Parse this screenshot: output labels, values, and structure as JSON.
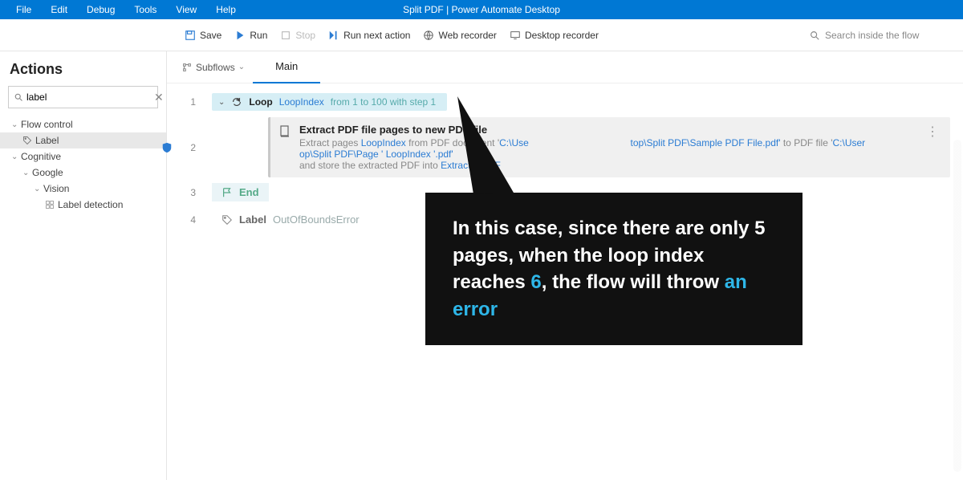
{
  "menubar": {
    "items": [
      "File",
      "Edit",
      "Debug",
      "Tools",
      "View",
      "Help"
    ],
    "title": "Split PDF | Power Automate Desktop"
  },
  "toolbar": {
    "save": "Save",
    "run": "Run",
    "stop": "Stop",
    "run_next": "Run next action",
    "web_rec": "Web recorder",
    "desk_rec": "Desktop recorder",
    "search_placeholder": "Search inside the flow"
  },
  "sidebar": {
    "title": "Actions",
    "search_value": "label",
    "tree": {
      "flow_control": "Flow control",
      "label_action": "Label",
      "cognitive": "Cognitive",
      "google": "Google",
      "vision": "Vision",
      "label_detection": "Label detection"
    }
  },
  "subflows": {
    "btn": "Subflows",
    "tab_main": "Main"
  },
  "flow": {
    "row1": {
      "num": "1",
      "name": "Loop",
      "var": "LoopIndex",
      "meta": "from 1 to 100 with step 1"
    },
    "row2": {
      "num": "2",
      "title": "Extract PDF file pages to new PDF file",
      "desc_pre": "Extract pages ",
      "var1": "LoopIndex",
      "desc_mid1": " from PDF document '",
      "path1": "C:\\Use",
      "path1b": "top\\Split PDF\\Sample PDF File.pdf'",
      "desc_mid2": " to PDF file '",
      "path2": "C:\\User",
      "path2b": "op\\Split PDF\\Page ' ",
      "var2": "LoopIndex",
      "path2c": " '.pdf'",
      "desc_line2_pre": "and store the extracted PDF into ",
      "var3": "ExtractedPDF"
    },
    "row3": {
      "num": "3",
      "name": "End"
    },
    "row4": {
      "num": "4",
      "name": "Label",
      "val": "OutOfBoundsError"
    }
  },
  "callout": {
    "t1": "In this case, since there are only 5 pages, when the loop index reaches ",
    "hl1": "6",
    "t2": ", the flow will throw ",
    "hl2": "an error"
  }
}
